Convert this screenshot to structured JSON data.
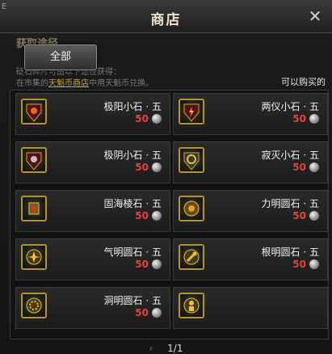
{
  "window": {
    "title": "商店",
    "corner_mark": "E"
  },
  "background_text": {
    "heading": "获取途径",
    "line1": "砭石碎片可由以下途径获得：",
    "line2_prefix": "在市集的",
    "line2_link": "天魁币商店",
    "line2_suffix": "中用天魁币兑换。"
  },
  "tabs": {
    "all_label": "全部"
  },
  "right_note": "可以购买的",
  "items": [
    {
      "name": "极阳小石 · 五",
      "price": "50",
      "icon": "sun-shield-icon"
    },
    {
      "name": "两仪小石 · 五",
      "price": "50",
      "icon": "lightning-shield-icon"
    },
    {
      "name": "极阴小石 · 五",
      "price": "50",
      "icon": "heart-shield-icon"
    },
    {
      "name": "寂灭小石 · 五",
      "price": "50",
      "icon": "cross-shield-icon"
    },
    {
      "name": "固海棱石 · 五",
      "price": "50",
      "icon": "prism-gem-icon"
    },
    {
      "name": "力明圆石 · 五",
      "price": "50",
      "icon": "fist-orb-icon"
    },
    {
      "name": "气明圆石 · 五",
      "price": "50",
      "icon": "star-orb-icon"
    },
    {
      "name": "根明圆石 · 五",
      "price": "50",
      "icon": "key-orb-icon"
    },
    {
      "name": "洞明圆石 · 五",
      "price": "50",
      "icon": "gear-orb-icon"
    },
    {
      "name": "",
      "price": "",
      "icon": "figure-orb-icon"
    }
  ],
  "pagination": {
    "prev": "‹",
    "page": "1/1"
  },
  "colors": {
    "price": "#e0443a",
    "frame": "#b39332",
    "link": "#c7a74a"
  }
}
